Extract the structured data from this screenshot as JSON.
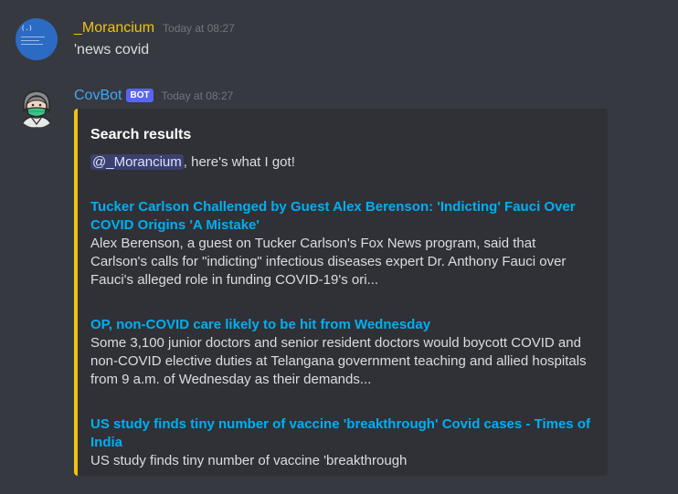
{
  "colors": {
    "background": "#36393f",
    "embed_background": "#2f3136",
    "embed_accent": "#f1c40f",
    "user1_name": "#f1c40f",
    "bot_name": "#3ea8ff",
    "link": "#00aff4",
    "bot_tag": "#5865f2"
  },
  "messages": [
    {
      "author": "_Morancium",
      "timestamp": "Today at 08:27",
      "text": "'news covid",
      "avatar_icon": "desktop-screenshot-avatar"
    },
    {
      "author": "CovBot",
      "bot_tag": "BOT",
      "timestamp": "Today at 08:27",
      "avatar_icon": "masked-person-avatar",
      "embed": {
        "title": "Search results",
        "mention": "@_Morancium",
        "description_suffix": ", here's what I got!",
        "results": [
          {
            "title": "Tucker Carlson Challenged by Guest Alex Berenson: 'Indicting' Fauci Over COVID Origins 'A Mistake'",
            "description": "Alex Berenson, a guest on Tucker Carlson's Fox News program, said that Carlson's calls for \"indicting\" infectious diseases expert Dr. Anthony Fauci over Fauci's alleged role in funding COVID-19's ori..."
          },
          {
            "title": "OP, non-COVID care likely to be hit from Wednesday",
            "description": "Some 3,100 junior doctors and senior resident doctors would boycott COVID and non-COVID elective duties at Telangana government teaching and allied hospitals from 9 a.m. of Wednesday as their demands..."
          },
          {
            "title": "US study finds tiny number of vaccine 'breakthrough' Covid cases - Times of India",
            "description": "US study finds tiny number of vaccine 'breakthrough"
          }
        ]
      }
    }
  ]
}
